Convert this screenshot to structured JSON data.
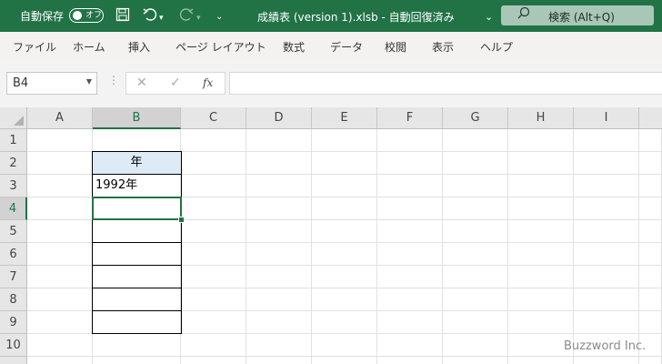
{
  "titlebar": {
    "autosave_label": "自動保存",
    "autosave_state": "オフ",
    "title": "成績表 (version 1).xlsb  -  自動回復済み",
    "search_placeholder": "検索 (Alt+Q)",
    "background": "#217346"
  },
  "menu": {
    "items": [
      "ファイル",
      "ホーム",
      "挿入",
      "ページ レイアウト",
      "数式",
      "データ",
      "校閲",
      "表示",
      "ヘルプ"
    ]
  },
  "formula_bar": {
    "name_box": "B4",
    "fx_label": "fx",
    "formula": ""
  },
  "sheet": {
    "columns": [
      "A",
      "B",
      "C",
      "D",
      "E",
      "F",
      "G",
      "H",
      "I"
    ],
    "rows": [
      "1",
      "2",
      "3",
      "4",
      "5",
      "6",
      "7",
      "8",
      "9",
      "10"
    ],
    "selected_column": "B",
    "selected_row": "4",
    "cells": {
      "B2": "年",
      "B3": "1992年"
    },
    "header_fill": "#ddebf7",
    "selection_color": "#217346"
  },
  "watermark": "Buzzword Inc."
}
